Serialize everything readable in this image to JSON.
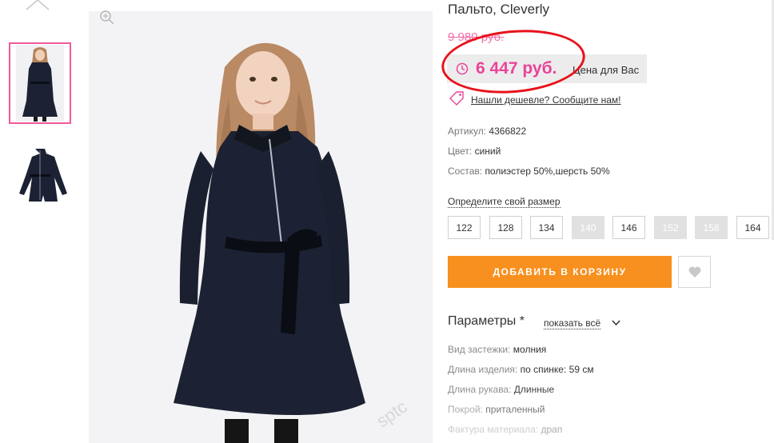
{
  "gallery": {
    "watermark": "sptc"
  },
  "product": {
    "title": "Пальто, Cleverly",
    "old_price": "9 980 руб.",
    "price": "6 447 руб.",
    "price_note": "Цена для Вас",
    "cheaper_link": "Нашли дешевле? Сообщите нам!",
    "specs": [
      {
        "key": "Артикул:",
        "value": "4366822"
      },
      {
        "key": "Цвет:",
        "value": "синий"
      },
      {
        "key": "Состав:",
        "value": "полиэстер 50%,шерсть 50%"
      }
    ],
    "size_label": "Определите свой размер",
    "sizes": [
      {
        "label": "122",
        "available": true
      },
      {
        "label": "128",
        "available": true
      },
      {
        "label": "134",
        "available": true
      },
      {
        "label": "140",
        "available": false
      },
      {
        "label": "146",
        "available": true
      },
      {
        "label": "152",
        "available": false
      },
      {
        "label": "158",
        "available": false
      },
      {
        "label": "164",
        "available": true
      }
    ],
    "add_to_cart": "ДОБАВИТЬ В КОРЗИНУ",
    "params_title": "Параметры *",
    "show_all": "показать всё",
    "params": [
      {
        "key": "Вид застежки:",
        "value": "молния"
      },
      {
        "key": "Длина изделия:",
        "value": "по спинке: 59 см"
      },
      {
        "key": "Длина рукава:",
        "value": "Длинные"
      },
      {
        "key": "Покрой:",
        "value": "приталенный"
      },
      {
        "key": "Фактура материала:",
        "value": "драп"
      }
    ]
  },
  "colors": {
    "accent_pink": "#e9449a",
    "old_price_pink": "#f36fa9",
    "cart_orange": "#f7901e",
    "highlight_red": "#e8121c",
    "coat_navy": "#1c2233"
  },
  "icons": [
    "chevron-up-icon",
    "zoom-icon",
    "clock-icon",
    "tag-icon",
    "heart-icon",
    "chevron-down-icon"
  ]
}
